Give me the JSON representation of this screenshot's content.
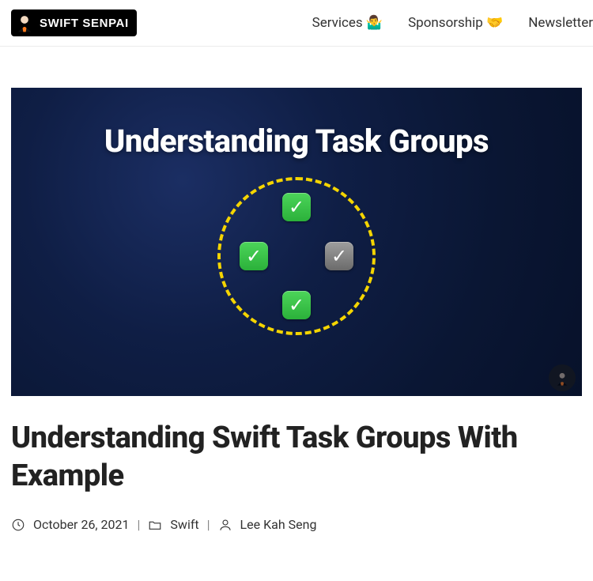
{
  "header": {
    "logo_text": "SWIFT SENPAI",
    "nav": [
      {
        "label": "Services",
        "emoji": "🤷‍♂️"
      },
      {
        "label": "Sponsorship",
        "emoji": "🤝"
      },
      {
        "label": "Newsletter",
        "emoji": ""
      }
    ]
  },
  "hero": {
    "title": "Understanding Task Groups"
  },
  "article": {
    "title": "Understanding Swift Task Groups With Example",
    "date": "October 26, 2021",
    "category": "Swift",
    "author": "Lee Kah Seng"
  }
}
